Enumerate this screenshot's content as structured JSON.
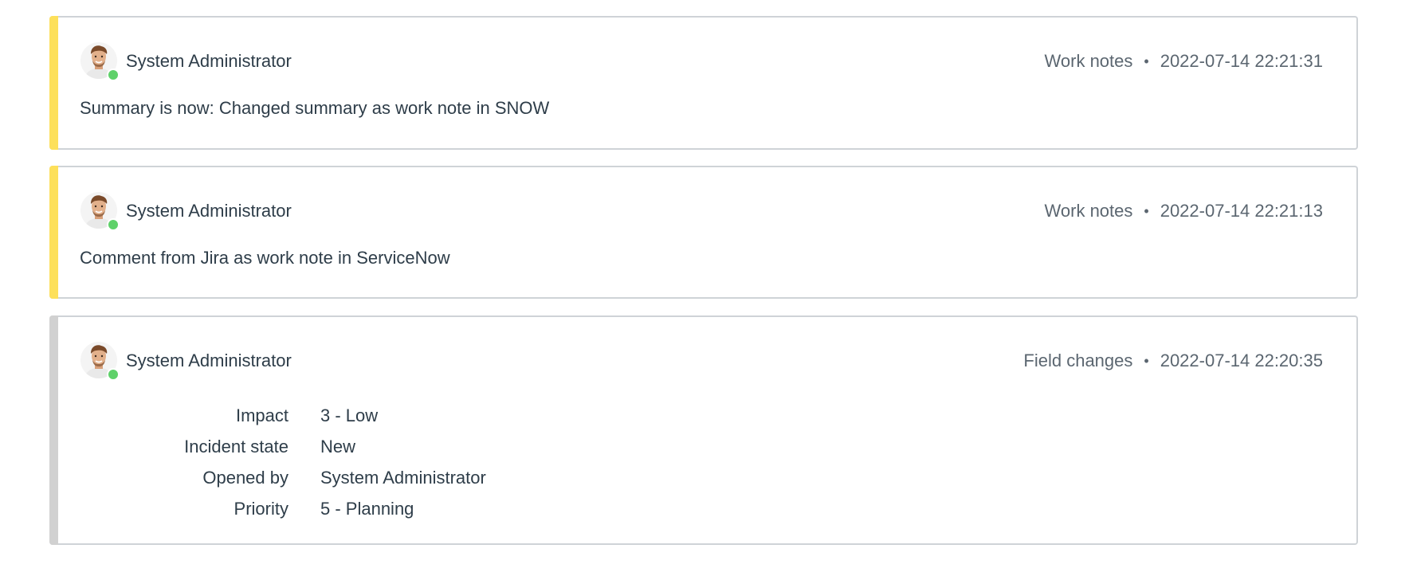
{
  "colors": {
    "work_note_stripe": "#fde05a",
    "field_change_stripe": "#d1d1d1",
    "presence_online": "#5fd16a"
  },
  "entries": [
    {
      "author": "System Administrator",
      "type": "Work notes",
      "timestamp": "2022-07-14 22:21:31",
      "text": "Summary is now: Changed summary as work note in SNOW"
    },
    {
      "author": "System Administrator",
      "type": "Work notes",
      "timestamp": "2022-07-14 22:21:13",
      "text": "Comment from Jira as work note in ServiceNow"
    },
    {
      "author": "System Administrator",
      "type": "Field changes",
      "timestamp": "2022-07-14 22:20:35",
      "changes": [
        {
          "field": "Impact",
          "value": "3 - Low"
        },
        {
          "field": "Incident state",
          "value": "New"
        },
        {
          "field": "Opened by",
          "value": "System Administrator"
        },
        {
          "field": "Priority",
          "value": "5 - Planning"
        }
      ]
    }
  ],
  "separator": "•",
  "icons": {
    "avatar": "user-avatar-icon",
    "presence": "presence-online-icon"
  }
}
